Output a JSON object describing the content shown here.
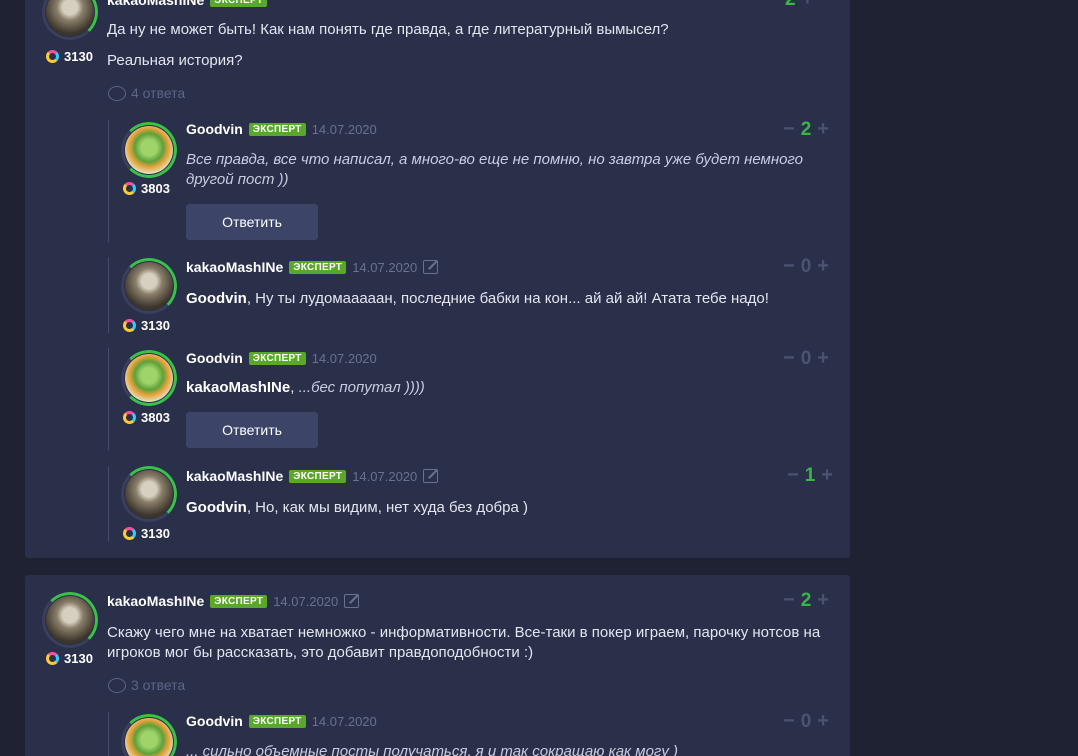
{
  "badge_label": "ЭКСПЕРТ",
  "reply_button_label": "Ответить",
  "comments": {
    "c1": {
      "author": "kakaoMashINe",
      "rating": "3130",
      "line1": "Да ну не может быть! Как нам понять где правда, а где литературный вымысел?",
      "line2": "Реальная история?",
      "replies": "4 ответа"
    },
    "r1": {
      "author": "Goodvin",
      "date": "14.07.2020",
      "rating": "3803",
      "vote": "2",
      "line1": "Все правда, все что написал, а много-во еще не помню, но завтра уже будет немного",
      "line2": "другой пост ))"
    },
    "r2": {
      "author": "kakaoMashINe",
      "date": "14.07.2020",
      "rating": "3130",
      "vote": "0",
      "mention": "Goodvin",
      "text": ", Ну ты лудомааааан, последние бабки на кон... ай ай ай! Атата тебе надо!"
    },
    "r3": {
      "author": "Goodvin",
      "date": "14.07.2020",
      "rating": "3803",
      "vote": "0",
      "mention": "kakaoMashINe",
      "text": "...бес попутал ))))"
    },
    "r4": {
      "author": "kakaoMashINe",
      "date": "14.07.2020",
      "rating": "3130",
      "vote": "1",
      "mention": "Goodvin",
      "text": ", Но, как мы видим, нет худа без добра )"
    },
    "c2": {
      "author": "kakaoMashINe",
      "date": "14.07.2020",
      "rating": "3130",
      "vote": "2",
      "line1": "Скажу чего мне на хватает немножко - информативности. Все-таки в покер играем, парочку нотсов на",
      "line2": "игроков мог бы рассказать, это добавит правдоподобности :)",
      "replies": "3 ответа"
    },
    "r5": {
      "author": "Goodvin",
      "date": "14.07.2020",
      "vote": "0",
      "text": "... сильно объемные посты получаться, я и так сокращаю как могу )"
    }
  },
  "icons": {
    "edit": "edit-icon",
    "comment": "comment-bubble-icon",
    "rating": "rating-ring-icon"
  },
  "colors": {
    "background": "#1f2233",
    "card": "#2a2f4a",
    "badge": "#5aa829",
    "vote_positive": "#39b54a",
    "button": "#3c4568"
  }
}
